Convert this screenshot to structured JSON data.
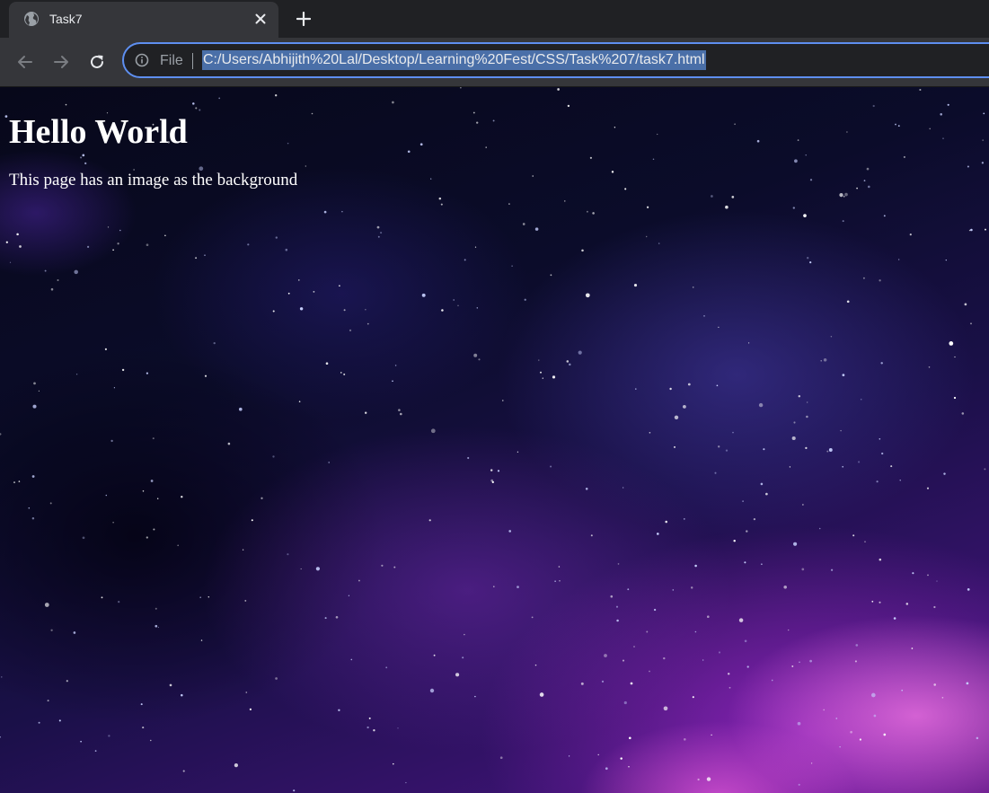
{
  "browser": {
    "tab": {
      "title": "Task7",
      "favicon": "globe-icon",
      "close_icon": "close-icon"
    },
    "new_tab_icon": "plus-icon",
    "toolbar": {
      "back_icon": "arrow-left-icon",
      "forward_icon": "arrow-right-icon",
      "reload_icon": "reload-icon"
    },
    "omnibox": {
      "info_icon": "info-icon",
      "scheme_label": "File",
      "url": "C:/Users/Abhijith%20Lal/Desktop/Learning%20Fest/CSS/Task%207/task7.html",
      "accent_color": "#5e8ff0"
    }
  },
  "page": {
    "heading": "Hello World",
    "paragraph": "This page has an image as the background",
    "background": "galaxy-starfield-image",
    "text_color": "#ffffff"
  }
}
